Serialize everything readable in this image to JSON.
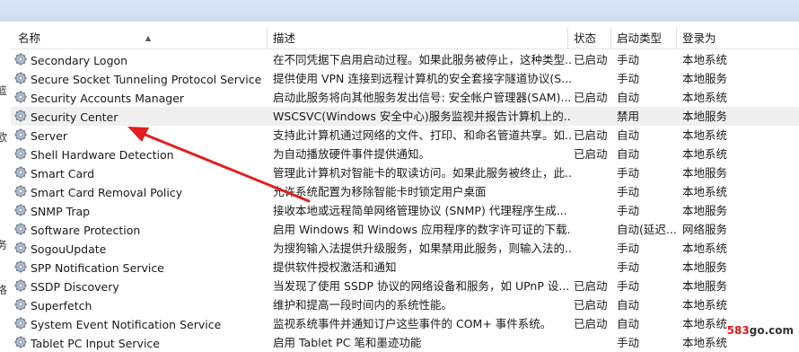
{
  "columns": {
    "name": "名称",
    "desc": "描述",
    "status": "状态",
    "startup": "启动类型",
    "logon": "登录为"
  },
  "left_edge_glyphs": [
    "篮",
    "欧",
    "务",
    "恪"
  ],
  "services": [
    {
      "name": "Secondary Logon",
      "desc": "在不同凭据下启用启动过程。如果此服务被停止，这种类型...",
      "status": "已启动",
      "startup": "手动",
      "logon": "本地系统"
    },
    {
      "name": "Secure Socket Tunneling Protocol Service",
      "desc": "提供使用 VPN 连接到远程计算机的安全套接字隧道协议(S...",
      "status": "",
      "startup": "手动",
      "logon": "本地服务"
    },
    {
      "name": "Security Accounts Manager",
      "desc": "启动此服务将向其他服务发出信号: 安全帐户管理器(SAM)...",
      "status": "已启动",
      "startup": "自动",
      "logon": "本地系统"
    },
    {
      "name": "Security Center",
      "desc": "WSCSVC(Windows 安全中心)服务监视并报告计算机上的...",
      "status": "",
      "startup": "禁用",
      "logon": "本地服务",
      "selected": true
    },
    {
      "name": "Server",
      "desc": "支持此计算机通过网络的文件、打印、和命名管道共享。如...",
      "status": "已启动",
      "startup": "自动",
      "logon": "本地系统"
    },
    {
      "name": "Shell Hardware Detection",
      "desc": "为自动播放硬件事件提供通知。",
      "status": "已启动",
      "startup": "自动",
      "logon": "本地系统"
    },
    {
      "name": "Smart Card",
      "desc": "管理此计算机对智能卡的取读访问。如果此服务被终止，此...",
      "status": "",
      "startup": "手动",
      "logon": "本地服务"
    },
    {
      "name": "Smart Card Removal Policy",
      "desc": "允许系统配置为移除智能卡时锁定用户桌面",
      "status": "",
      "startup": "手动",
      "logon": "本地系统"
    },
    {
      "name": "SNMP Trap",
      "desc": "接收本地或远程简单网络管理协议 (SNMP) 代理程序生成...",
      "status": "",
      "startup": "手动",
      "logon": "本地服务"
    },
    {
      "name": "Software Protection",
      "desc": "启用 Windows 和 Windows 应用程序的数字许可证的下载...",
      "status": "",
      "startup": "自动(延迟...",
      "logon": "网络服务"
    },
    {
      "name": "SogouUpdate",
      "desc": "为搜狗输入法提供升级服务，如果禁用此服务，则输入法的...",
      "status": "",
      "startup": "手动",
      "logon": "本地系统"
    },
    {
      "name": "SPP Notification Service",
      "desc": "提供软件授权激活和通知",
      "status": "",
      "startup": "手动",
      "logon": "本地服务"
    },
    {
      "name": "SSDP Discovery",
      "desc": "当发现了使用 SSDP 协议的网络设备和服务，如 UPnP 设...",
      "status": "已启动",
      "startup": "手动",
      "logon": "本地服务"
    },
    {
      "name": "Superfetch",
      "desc": "维护和提高一段时间内的系统性能。",
      "status": "已启动",
      "startup": "自动",
      "logon": "本地系统"
    },
    {
      "name": "System Event Notification Service",
      "desc": "监视系统事件并通知订户这些事件的 COM+ 事件系统。",
      "status": "已启动",
      "startup": "自动",
      "logon": "本地系统"
    },
    {
      "name": "Tablet PC Input Service",
      "desc": "启用 Tablet PC 笔和墨迹功能",
      "status": "",
      "startup": "手动",
      "logon": "本地系统"
    }
  ],
  "watermark": {
    "number": "583",
    "domain": "go.com"
  },
  "colors": {
    "arrow": "#e02020",
    "selected_row": "#f0f0f0",
    "header_bar": "#d5e2f2"
  }
}
